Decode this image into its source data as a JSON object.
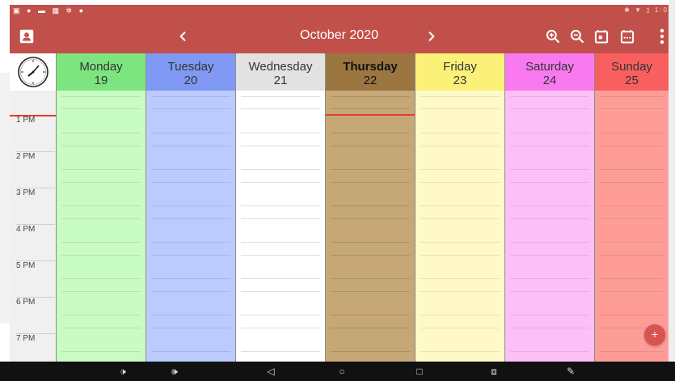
{
  "status_bar": {
    "left_icons": [
      "image-icon",
      "location-icon",
      "message-icon",
      "grid-icon",
      "settings-icon",
      "chat-icon"
    ],
    "right_text": "1:0",
    "right_icons": [
      "bluetooth-icon",
      "wifi-icon",
      "battery-icon"
    ]
  },
  "app_bar": {
    "title": "October 2020",
    "color": "#c2504a",
    "left_icon": "contact-book-icon",
    "actions": [
      "zoom-in-icon",
      "zoom-out-icon",
      "today-icon",
      "calendar-week-icon",
      "more-vert-icon"
    ]
  },
  "days": [
    {
      "name": "Monday",
      "num": "19",
      "header_color": "#7de57f",
      "body_color": "#c9fcc2",
      "line_color": "#b2e3ad"
    },
    {
      "name": "Tuesday",
      "num": "20",
      "header_color": "#7f99f5",
      "body_color": "#bccbfd",
      "line_color": "#a6b6ea"
    },
    {
      "name": "Wednesday",
      "num": "21",
      "header_color": "#e2e2e2",
      "body_color": "#ffffff",
      "line_color": "#dedede"
    },
    {
      "name": "Thursday",
      "num": "22",
      "header_color": "#9c7640",
      "body_color": "#c6a877",
      "line_color": "#ad9062"
    },
    {
      "name": "Friday",
      "num": "23",
      "header_color": "#fbf178",
      "body_color": "#fef9c6",
      "line_color": "#ebe3ad"
    },
    {
      "name": "Saturday",
      "num": "24",
      "header_color": "#f97af0",
      "body_color": "#fdc0f6",
      "line_color": "#ecaae4"
    },
    {
      "name": "Sunday",
      "num": "25",
      "header_color": "#f95f5f",
      "body_color": "#fe9d97",
      "line_color": "#ec8c86"
    }
  ],
  "times": [
    "1 PM",
    "2 PM",
    "3 PM",
    "4 PM",
    "5 PM",
    "6 PM",
    "7 PM"
  ],
  "current_time_color": "#e53935",
  "fab": {
    "label": "+"
  },
  "nav_bar": {
    "buttons": [
      "volume-down-icon",
      "volume-up-icon",
      "back-icon",
      "home-icon",
      "recents-icon",
      "screenshot-icon",
      "pen-icon"
    ]
  }
}
